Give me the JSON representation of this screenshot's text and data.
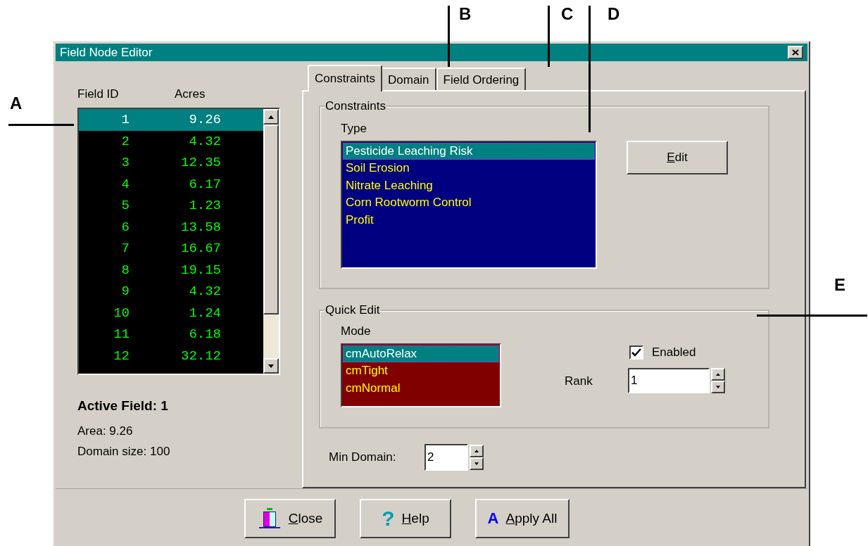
{
  "callouts": [
    {
      "label": "A"
    },
    {
      "label": "B"
    },
    {
      "label": "C"
    },
    {
      "label": "D"
    },
    {
      "label": "E"
    }
  ],
  "window": {
    "title": "Field Node Editor"
  },
  "fields": {
    "columns": [
      "Field ID",
      "Acres"
    ],
    "rows": [
      {
        "id": "1",
        "acres": "9.26",
        "selected": true
      },
      {
        "id": "2",
        "acres": "4.32",
        "selected": false
      },
      {
        "id": "3",
        "acres": "12.35",
        "selected": false
      },
      {
        "id": "4",
        "acres": "6.17",
        "selected": false
      },
      {
        "id": "5",
        "acres": "1.23",
        "selected": false
      },
      {
        "id": "6",
        "acres": "13.58",
        "selected": false
      },
      {
        "id": "7",
        "acres": "16.67",
        "selected": false
      },
      {
        "id": "8",
        "acres": "19.15",
        "selected": false
      },
      {
        "id": "9",
        "acres": "4.32",
        "selected": false
      },
      {
        "id": "10",
        "acres": "1.24",
        "selected": false
      },
      {
        "id": "11",
        "acres": "6.18",
        "selected": false
      },
      {
        "id": "12",
        "acres": "32.12",
        "selected": false
      }
    ]
  },
  "active_field": {
    "heading": "Active Field: 1",
    "area": "Area: 9.26",
    "domain_size": "Domain size: 100"
  },
  "tabs": [
    {
      "label": "Constraints",
      "selected": true
    },
    {
      "label": "Domain",
      "selected": false
    },
    {
      "label": "Field Ordering",
      "selected": false
    }
  ],
  "constraints": {
    "group_title": "Constraints",
    "list_label": "Type",
    "items": [
      {
        "label": "Pesticide Leaching Risk",
        "selected": true
      },
      {
        "label": "Soil Erosion",
        "selected": false
      },
      {
        "label": "Nitrate Leaching",
        "selected": false
      },
      {
        "label": "Corn Rootworm Control",
        "selected": false
      },
      {
        "label": "Profit",
        "selected": false
      }
    ],
    "edit_button": {
      "label": "Edit",
      "underlined_first": true
    }
  },
  "quick_edit": {
    "group_title": "Quick Edit",
    "mode_label": "Mode",
    "modes": [
      {
        "label": "cmAutoRelax",
        "selected": true
      },
      {
        "label": "cmTight",
        "selected": false
      },
      {
        "label": "cmNormal",
        "selected": false
      }
    ],
    "enabled": {
      "label": "Enabled",
      "checked": true
    },
    "rank": {
      "label": "Rank",
      "value": "1"
    }
  },
  "min_domain": {
    "label": "Min Domain:",
    "value": "2"
  },
  "buttons": [
    {
      "kind": "close",
      "label": "Close",
      "underlined_first": true
    },
    {
      "kind": "help",
      "icon": "?",
      "label": "Help",
      "underlined_first": true
    },
    {
      "kind": "apply",
      "icon": "A",
      "label": "Apply All",
      "underlined_first": true
    }
  ]
}
